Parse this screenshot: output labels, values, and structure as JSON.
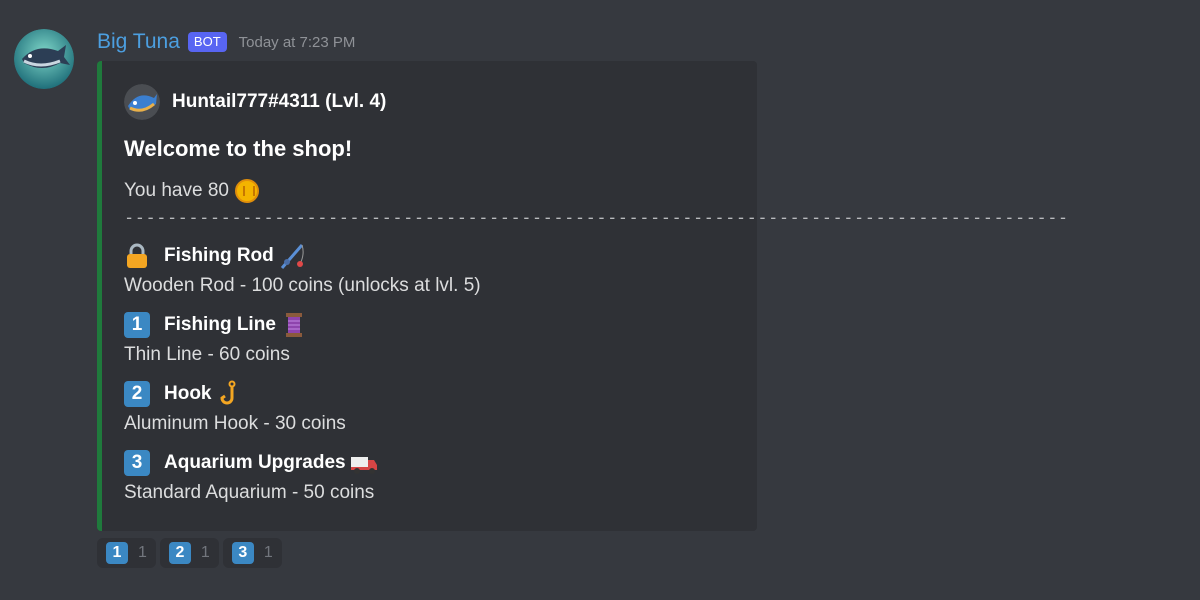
{
  "message": {
    "username": "Big Tuna",
    "bot_tag": "BOT",
    "timestamp": "Today at 7:23 PM"
  },
  "embed": {
    "author": "Huntail777#4311 (Lvl. 4)",
    "title": "Welcome to the shop!",
    "balance_text": "You have 80",
    "divider": "----------------------------------------------------------------------------------------",
    "items": [
      {
        "marker": "lock",
        "name": "Fishing Rod",
        "emoji": "fishing-pole-icon",
        "desc": "Wooden Rod - 100 coins (unlocks at lvl. 5)"
      },
      {
        "marker": "1",
        "name": "Fishing Line",
        "emoji": "thread-spool-icon",
        "desc": "Thin Line - 60 coins"
      },
      {
        "marker": "2",
        "name": "Hook",
        "emoji": "hook-icon",
        "desc": "Aluminum Hook - 30 coins"
      },
      {
        "marker": "3",
        "name": "Aquarium Upgrades",
        "emoji": "truck-icon",
        "desc": "Standard Aquarium - 50 coins"
      }
    ],
    "accent_color": "#1f7a3c"
  },
  "reactions": [
    {
      "emoji": "1",
      "count": "1"
    },
    {
      "emoji": "2",
      "count": "1"
    },
    {
      "emoji": "3",
      "count": "1"
    }
  ]
}
